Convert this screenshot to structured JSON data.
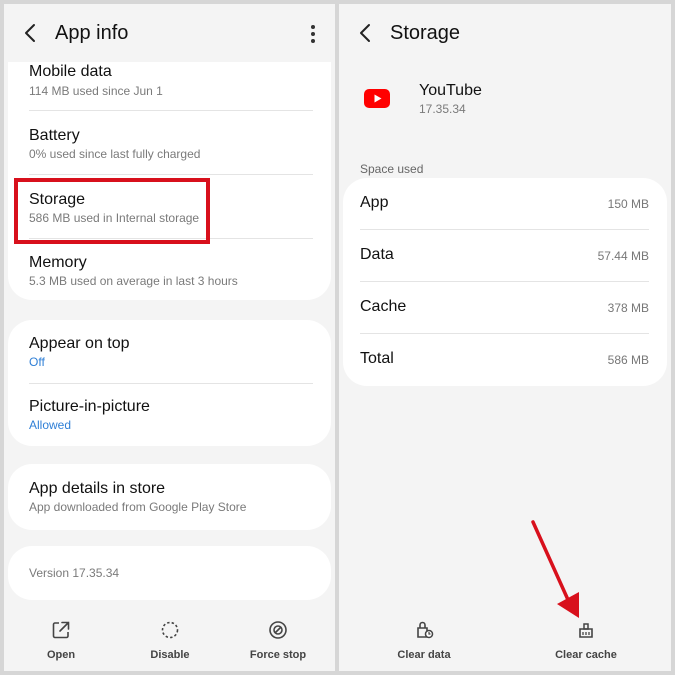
{
  "left": {
    "header": {
      "title": "App info"
    },
    "usage_card": [
      {
        "label": "Mobile data",
        "sub": "114 MB used since Jun 1"
      },
      {
        "label": "Battery",
        "sub": "0% used since last fully charged"
      },
      {
        "label": "Storage",
        "sub": "586 MB used in Internal storage"
      },
      {
        "label": "Memory",
        "sub": "5.3 MB used on average in last 3 hours"
      }
    ],
    "permissions_card": [
      {
        "label": "Appear on top",
        "sub": "Off"
      },
      {
        "label": "Picture-in-picture",
        "sub": "Allowed"
      }
    ],
    "store_card": {
      "label": "App details in store",
      "sub": "App downloaded from Google Play Store"
    },
    "version": "Version 17.35.34",
    "bottom_actions": {
      "open": "Open",
      "disable": "Disable",
      "force_stop": "Force stop"
    }
  },
  "right": {
    "header": {
      "title": "Storage"
    },
    "app": {
      "name": "YouTube",
      "version": "17.35.34"
    },
    "section_title": "Space used",
    "space": [
      {
        "label": "App",
        "value": "150 MB"
      },
      {
        "label": "Data",
        "value": "57.44 MB"
      },
      {
        "label": "Cache",
        "value": "378 MB"
      },
      {
        "label": "Total",
        "value": "586 MB"
      }
    ],
    "bottom_actions": {
      "clear_data": "Clear data",
      "clear_cache": "Clear cache"
    }
  },
  "colors": {
    "highlight": "#d8101c",
    "link": "#2f7fd6",
    "youtube": "#ff0000"
  }
}
